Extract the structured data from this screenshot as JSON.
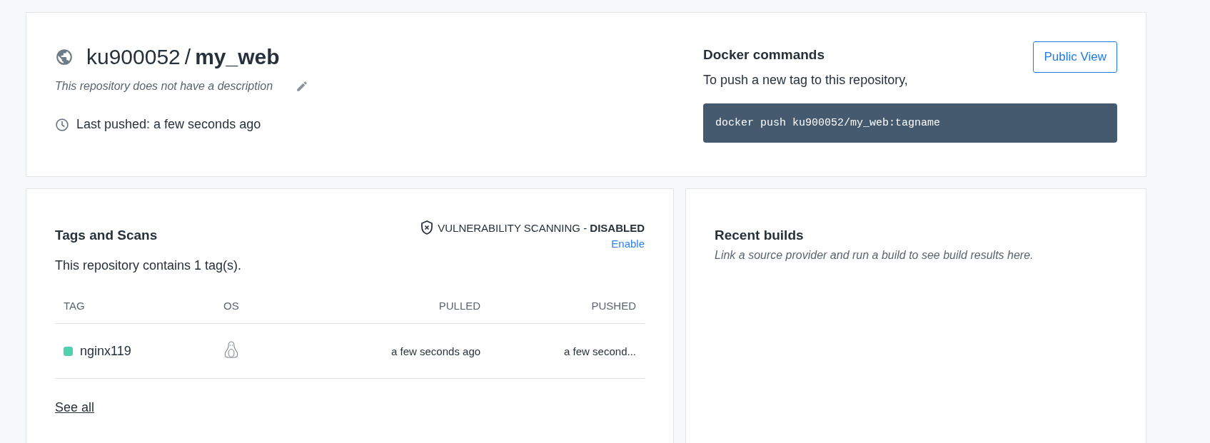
{
  "repository": {
    "namespace": "ku900052",
    "separator": "/",
    "name": "my_web",
    "description": "This repository does not have a description",
    "last_pushed": "Last pushed: a few seconds ago"
  },
  "docker_commands": {
    "title": "Docker commands",
    "button": "Public View",
    "instruction": "To push a new tag to this repository,",
    "command": "docker push ku900052/my_web:tagname"
  },
  "tags_and_scans": {
    "title": "Tags and Scans",
    "scanning": "VULNERABILITY SCANNING - **DISABLED**",
    "enable_link": "Enable",
    "summary": "This repository contains 1 tag(s).",
    "columns": [
      "TAG",
      "OS",
      "PULLED",
      "PUSHED"
    ],
    "rows": [
      {
        "tag": "nginx119",
        "color": "#4fd1b0",
        "pulled": "a few seconds ago",
        "pushed": "a few second..."
      }
    ],
    "see_all": "See all"
  },
  "recent_builds": {
    "title": "Recent builds",
    "message": "Link a source provider and run a build to see build results here."
  }
}
